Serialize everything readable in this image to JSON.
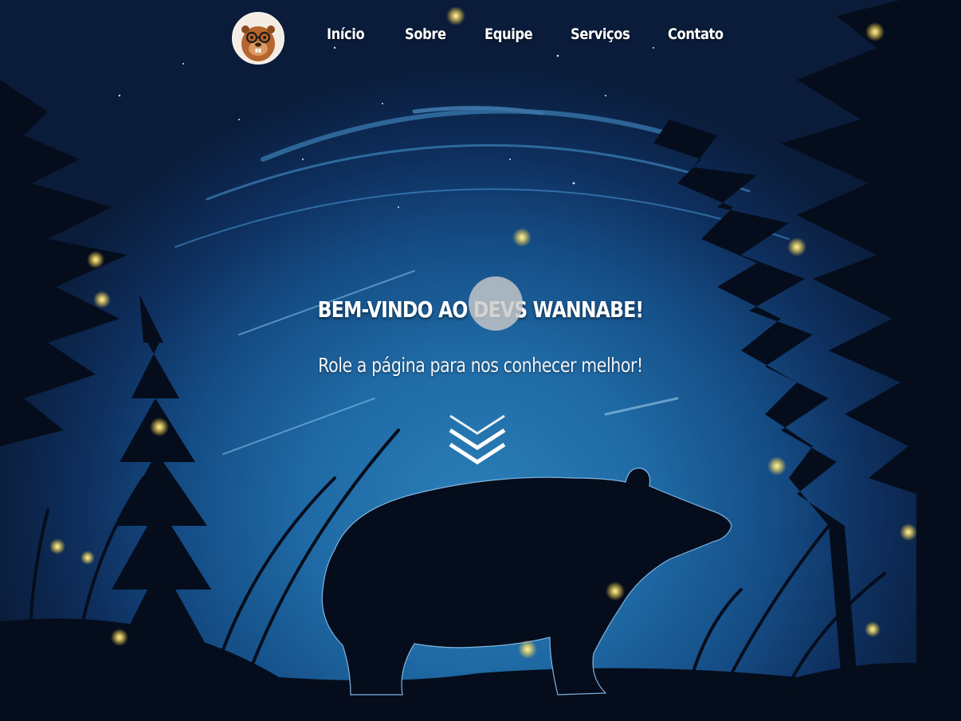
{
  "nav": {
    "logo_icon": "beaver-with-glasses-icon",
    "items": [
      {
        "label": "Início"
      },
      {
        "label": "Sobre"
      },
      {
        "label": "Equipe"
      },
      {
        "label": "Serviços"
      },
      {
        "label": "Contato"
      }
    ]
  },
  "hero": {
    "title": "BEM-VINDO AO DEVS WANNABE!",
    "subtitle": "Role a página para nos conhecer melhor!",
    "scroll_icon": "double-chevron-down-icon"
  },
  "background": {
    "scene": "night-forest-bear-silhouette",
    "colors": {
      "sky_center": "#2b7fb8",
      "sky_edge": "#0a1c3a",
      "silhouette": "#050d1c",
      "firefly": "#ffe36b"
    }
  }
}
